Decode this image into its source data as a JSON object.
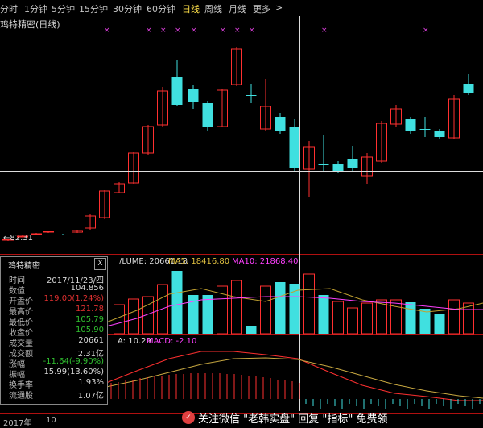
{
  "timeframes": [
    {
      "label": "分时",
      "active": false
    },
    {
      "label": "1分钟",
      "active": false
    },
    {
      "label": "5分钟",
      "active": false
    },
    {
      "label": "15分钟",
      "active": false
    },
    {
      "label": "30分钟",
      "active": false
    },
    {
      "label": "60分钟",
      "active": false
    },
    {
      "label": "日线",
      "active": true
    },
    {
      "label": "周线",
      "active": false
    },
    {
      "label": "月线",
      "active": false
    },
    {
      "label": "更多",
      "active": false
    }
  ],
  "more_arrow": ">",
  "price_title": "鸡特精密(日线)",
  "volume_line": {
    "prefix": "/LUME: 20661.18",
    "ma5": "MA5: 18416.80",
    "ma10": "MA10: 21868.40"
  },
  "macd_line": {
    "prefix": "A: 10.29",
    "macd": "MACD: -2.10"
  },
  "low_label": "←82.31",
  "popup": {
    "title": "鸡特精密",
    "close": "X",
    "rows": [
      {
        "label": "时间",
        "value": "2017/11/23/四",
        "color": "#d8d8d8"
      },
      {
        "label": "数值",
        "value": "104.856",
        "color": "#d8d8d8"
      },
      {
        "label": "开盘价",
        "value": "119.00(1.24%)",
        "color": "#e03030"
      },
      {
        "label": "最高价",
        "value": "121.78",
        "color": "#e03030"
      },
      {
        "label": "最低价",
        "value": "105.79",
        "color": "#30c030"
      },
      {
        "label": "收盘价",
        "value": "105.90",
        "color": "#30c030"
      },
      {
        "label": "成交量",
        "value": "20661",
        "color": "#d8d8d8"
      },
      {
        "label": "成交额",
        "value": "2.31亿",
        "color": "#d8d8d8"
      },
      {
        "label": "涨幅",
        "value": "-11.64(-9.90%)",
        "color": "#30c030"
      },
      {
        "label": "振幅",
        "value": "15.99(13.60%)",
        "color": "#d8d8d8"
      },
      {
        "label": "换手率",
        "value": "1.93%",
        "color": "#d8d8d8"
      },
      {
        "label": "流通股",
        "value": "1.07亿",
        "color": "#d8d8d8"
      }
    ]
  },
  "bottom_axis": {
    "year": "2017年",
    "month": "10"
  },
  "watermark": "关注微信 \"老韩实盘\" 回复 \"指标\" 免费领",
  "colors": {
    "up": "#ff3030",
    "down": "#40e0e0",
    "ma5": "#c0a030",
    "ma10": "#ff40ff",
    "grid": "#b01010"
  }
}
